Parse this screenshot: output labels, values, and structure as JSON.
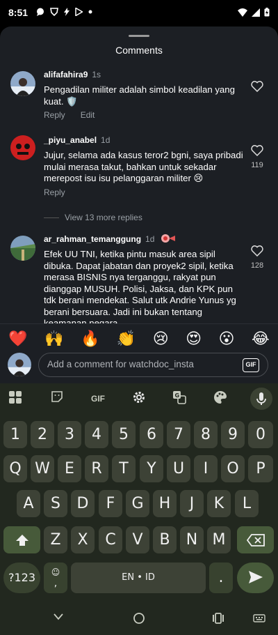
{
  "status": {
    "time": "8:51"
  },
  "sheet": {
    "title": "Comments"
  },
  "comments": [
    {
      "username": "alifafahira9",
      "time": "1s",
      "text": "Pengadilan militer adalah simbol keadilan yang kuat. 🛡️",
      "reply": "Reply",
      "edit": "Edit",
      "likes": ""
    },
    {
      "username": "_piyu_anabel",
      "time": "1d",
      "text": "Jujur, selama ada kasus teror2 bgni, saya pribadi mulai merasa takut, bahkan untuk sekadar merepost isu isu pelanggaran militer 😢",
      "reply": "Reply",
      "likes": "119"
    },
    {
      "username": "ar_rahman_temanggung",
      "time": "1d",
      "text": "Efek UU TNI, ketika pintu masuk area sipil dibuka. Dapat jabatan dan proyek2 sipil, ketika merasa BISNIS nya terganggu, rakyat pun dianggap MUSUH. Polisi, Jaksa, dan KPK pun tdk berani mendekat. Salut utk Andrie Yunus yg berani bersuara. Jadi ini bukan tentang keamanan negara.",
      "likes": "128"
    }
  ],
  "more_replies": "View 13 more replies",
  "emojis": [
    "❤️",
    "🙌",
    "🔥",
    "👏",
    "😢",
    "😍",
    "😮",
    "😂"
  ],
  "input": {
    "placeholder": "Add a comment for watchdoc_insta",
    "gif": "GIF"
  },
  "keyboard": {
    "toolbar_gif": "GIF",
    "row_numbers": [
      "1",
      "2",
      "3",
      "4",
      "5",
      "6",
      "7",
      "8",
      "9",
      "0"
    ],
    "row_q": [
      "Q",
      "W",
      "E",
      "R",
      "T",
      "Y",
      "U",
      "I",
      "O",
      "P"
    ],
    "row_a": [
      "A",
      "S",
      "D",
      "F",
      "G",
      "H",
      "J",
      "K",
      "L"
    ],
    "row_z": [
      "Z",
      "X",
      "C",
      "V",
      "B",
      "N",
      "M"
    ],
    "symbols": "?123",
    "comma": ",",
    "space": "EN • ID",
    "period": "."
  }
}
